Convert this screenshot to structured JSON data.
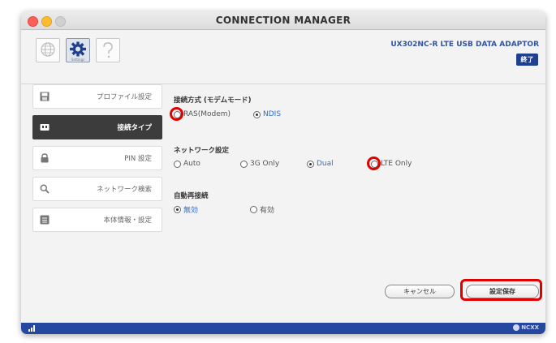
{
  "window": {
    "title": "CONNECTION MANAGER"
  },
  "toolbar": {
    "icons": [
      {
        "name": "globe-icon"
      },
      {
        "name": "gear-icon",
        "caption": "Settings"
      },
      {
        "name": "help-icon"
      }
    ],
    "product": "UX302NC-R LTE USB DATA ADAPTOR",
    "exit_label": "終了"
  },
  "sidebar": {
    "items": [
      {
        "label": "プロファイル設定",
        "icon": "save-icon"
      },
      {
        "label": "接続タイプ",
        "icon": "connection-icon",
        "active": true
      },
      {
        "label": "PIN 設定",
        "icon": "lock-icon"
      },
      {
        "label": "ネットワーク検索",
        "icon": "search-icon"
      },
      {
        "label": "本体情報・設定",
        "icon": "info-icon"
      }
    ]
  },
  "main": {
    "connection_mode": {
      "title": "接続方式 (モデムモード)",
      "options": [
        {
          "label": "RAS(Modem)",
          "selected": false
        },
        {
          "label": "NDIS",
          "selected": true
        }
      ]
    },
    "network": {
      "title": "ネットワーク設定",
      "options": [
        {
          "label": "Auto",
          "selected": false
        },
        {
          "label": "3G Only",
          "selected": false
        },
        {
          "label": "Dual",
          "selected": true
        },
        {
          "label": "LTE Only",
          "selected": false
        }
      ]
    },
    "auto_reconnect": {
      "title": "自動再接続",
      "options": [
        {
          "label": "無効",
          "selected": true
        },
        {
          "label": "有効",
          "selected": false
        }
      ]
    }
  },
  "buttons": {
    "cancel": "キャンセル",
    "save": "設定保存"
  },
  "footer": {
    "brand": "NCXX"
  },
  "colors": {
    "accent": "#2f55a4",
    "footer": "#24479f",
    "highlight": "#e00000",
    "selected_text": "#2f6fd6"
  }
}
